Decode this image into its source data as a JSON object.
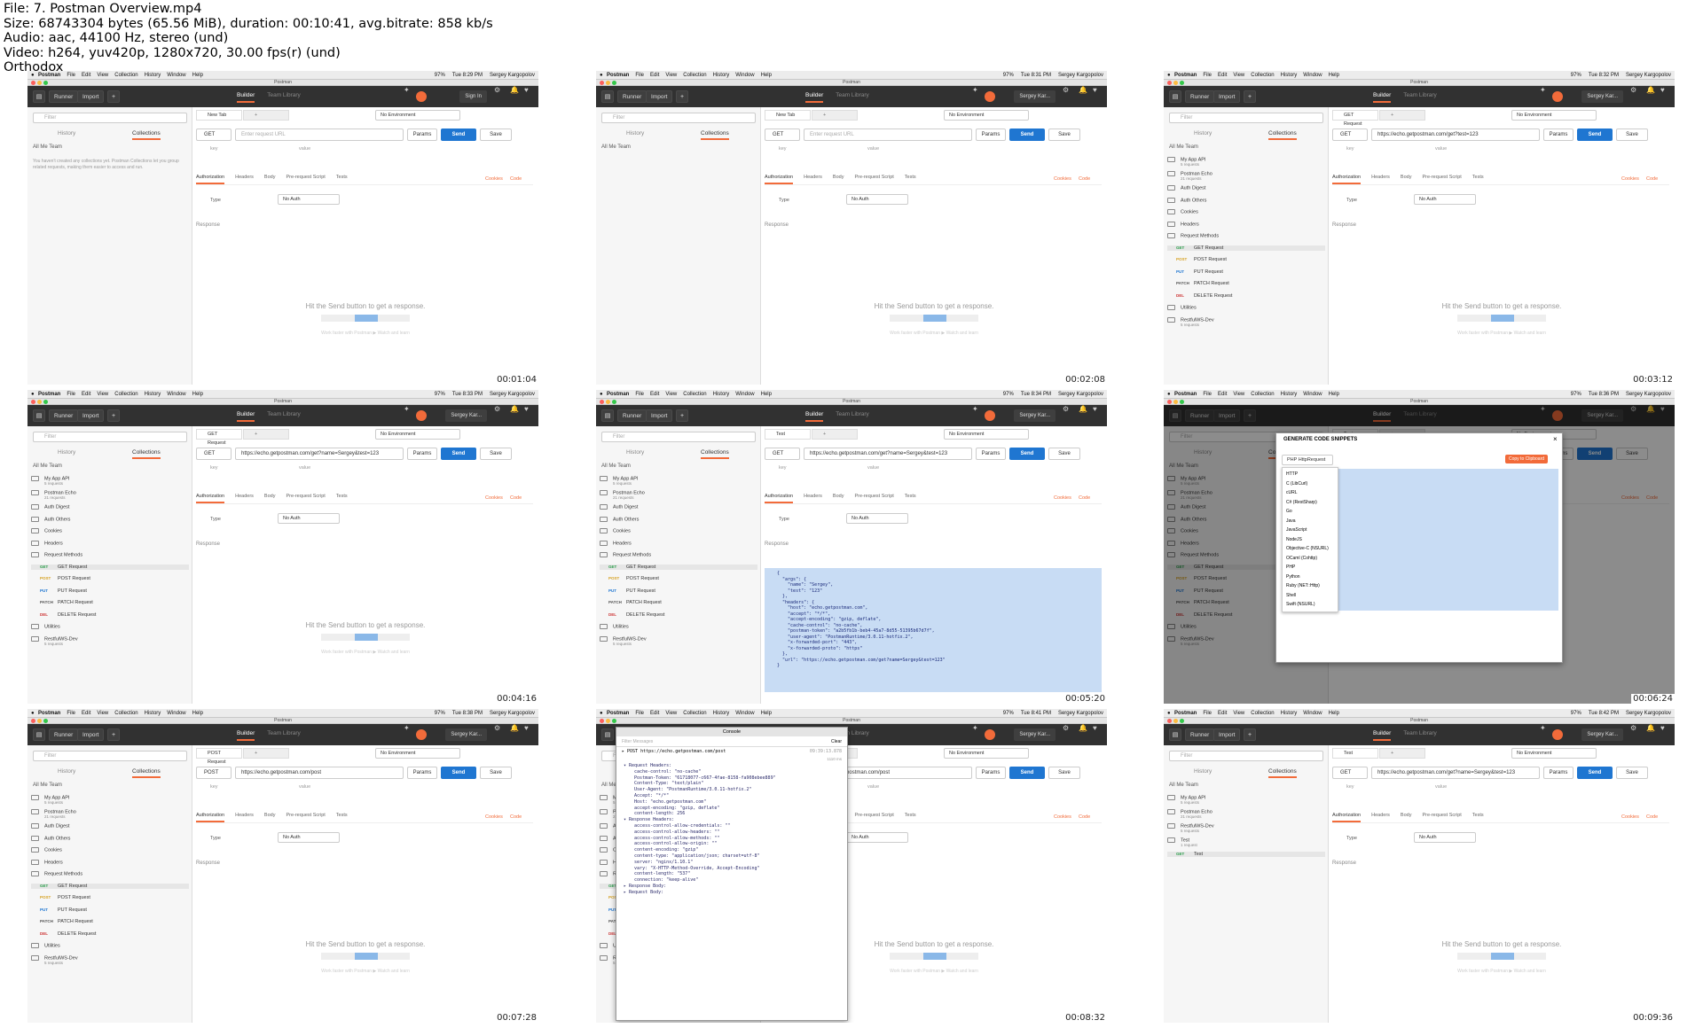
{
  "header": {
    "file": "File: 7. Postman Overview.mp4",
    "size": "Size: 68743304 bytes (65.56 MiB), duration: 00:10:41, avg.bitrate: 858 kb/s",
    "audio": "Audio: aac, 44100 Hz, stereo (und)",
    "video": "Video: h264, yuv420p, 1280x720, 30.00 fps(r) (und)",
    "brand": "Orthodox"
  },
  "common": {
    "apple": "",
    "app_name": "Postman",
    "menus": [
      "File",
      "Edit",
      "View",
      "Collection",
      "History",
      "Window",
      "Help"
    ],
    "battery": "97%",
    "user_name": "Sergey Kargopolov",
    "window_title": "Postman",
    "runner": "Runner",
    "import": "Import",
    "builder": "Builder",
    "team_library": "Team Library",
    "sign_in": "Sign In",
    "user_short": "Sergey Kar...",
    "filter": "Filter",
    "history": "History",
    "collections": "Collections",
    "me_team": "All  Me  Team",
    "new_tab": "New Tab",
    "no_env": "No Environment",
    "enter_url": "Enter request URL",
    "params": "Params",
    "send": "Send",
    "save": "Save",
    "key": "key",
    "value": "value",
    "bulk_edit": "Bulk Edit",
    "presets": "Presets",
    "cookies": "Cookies",
    "code": "Code",
    "response": "Response",
    "hit_send": "Hit the Send button to get a response.",
    "work_faster": "Work faster with Postman  ▶  Watch and learn",
    "sub_tabs": [
      "Authorization",
      "Headers",
      "Body",
      "Pre-request Script",
      "Tests"
    ],
    "type": "Type",
    "no_auth": "No Auth",
    "empty_msg": "You haven't created any collections yet. Postman Collections let you group related requests, making them easier to access and run."
  },
  "cells": [
    {
      "time": "Tue 8:29 PM",
      "ts": "00:01:04",
      "variant": "empty",
      "tab": "New Tab",
      "method": "GET",
      "url": ""
    },
    {
      "time": "Tue 8:31 PM",
      "ts": "00:02:08",
      "variant": "empty2",
      "tab": "New Tab",
      "method": "GET",
      "url": ""
    },
    {
      "time": "Tue 8:32 PM",
      "ts": "00:03:12",
      "variant": "list",
      "tab": "GET Request",
      "method": "GET",
      "url": "https://echo.getpostman.com/get?test=123"
    },
    {
      "time": "Tue 8:33 PM",
      "ts": "00:04:16",
      "variant": "list",
      "tab": "GET Request",
      "method": "GET",
      "url": "https://echo.getpostman.com/get?name=Sergey&test=123"
    },
    {
      "time": "Tue 8:34 PM",
      "ts": "00:05:20",
      "variant": "json",
      "tab": "Test",
      "method": "GET",
      "url": "https://echo.getpostman.com/get?name=Sergey&test=123"
    },
    {
      "time": "Tue 8:36 PM",
      "ts": "00:06:24",
      "variant": "modal",
      "tab": "Test",
      "method": "GET",
      "url": ""
    },
    {
      "time": "Tue 8:38 PM",
      "ts": "00:07:28",
      "variant": "list",
      "tab": "POST Request",
      "method": "POST",
      "url": "https://echo.getpostman.com/post"
    },
    {
      "time": "Tue 8:41 PM",
      "ts": "00:08:32",
      "variant": "console",
      "tab": "Test",
      "method": "POST",
      "url": "https://echo.getpostman.com/post"
    },
    {
      "time": "Tue 8:42 PM",
      "ts": "00:09:36",
      "variant": "list2",
      "tab": "Test",
      "method": "GET",
      "url": "https://echo.getpostman.com/get?name=Sergey&test=123"
    }
  ],
  "sidebar_list": [
    {
      "label": "My App API",
      "sub": "5 requests",
      "type": "folder"
    },
    {
      "label": "Postman Echo",
      "sub": "21 requests",
      "type": "folder"
    },
    {
      "label": "Auth Digest",
      "type": "folder"
    },
    {
      "label": "Auth Others",
      "type": "folder"
    },
    {
      "label": "Cookies",
      "type": "folder"
    },
    {
      "label": "Headers",
      "type": "folder"
    },
    {
      "label": "Request Methods",
      "type": "folder"
    },
    {
      "label": "GET Request",
      "method": "GET",
      "type": "req",
      "sel": true
    },
    {
      "label": "POST Request",
      "method": "POST",
      "type": "req"
    },
    {
      "label": "PUT Request",
      "method": "PUT",
      "type": "req"
    },
    {
      "label": "PATCH Request",
      "method": "PATCH",
      "type": "req"
    },
    {
      "label": "DELETE Request",
      "method": "DEL",
      "type": "req"
    },
    {
      "label": "Utilities",
      "type": "folder"
    },
    {
      "label": "RestfulWS-Dev",
      "sub": "5 requests",
      "type": "folder"
    }
  ],
  "sidebar_list2": [
    {
      "label": "My App API",
      "sub": "5 requests",
      "type": "folder"
    },
    {
      "label": "Postman Echo",
      "sub": "21 requests",
      "type": "folder"
    },
    {
      "label": "RestfulWS-Dev",
      "sub": "5 requests",
      "type": "folder"
    },
    {
      "label": "Test",
      "sub": "1 request",
      "type": "folder"
    },
    {
      "label": "Test",
      "method": "GET",
      "type": "req",
      "sel": true
    }
  ],
  "json_lines": [
    "{",
    "  \"args\": {",
    "    \"name\": \"Sergey\",",
    "    \"test\": \"123\"",
    "  },",
    "  \"headers\": {",
    "    \"host\": \"echo.getpostman.com\",",
    "    \"accept\": \"*/*\",",
    "    \"accept-encoding\": \"gzip, deflate\",",
    "    \"cache-control\": \"no-cache\",",
    "    \"postman-token\": \"a2b5fb1b-beb4-45a7-8d55-51395b67d7f\",",
    "    \"user-agent\": \"PostmanRuntime/3.0.11-hotfix.2\",",
    "    \"x-forwarded-port\": \"443\",",
    "    \"x-forwarded-proto\": \"https\"",
    "  },",
    "  \"url\": \"https://echo.getpostman.com/get?name=Sergey&test=123\"",
    "}"
  ],
  "modal": {
    "title": "GENERATE CODE SNIPPETS",
    "lang": "PHP HttpRequest",
    "copy": "Copy to Clipboard",
    "langs": [
      "HTTP",
      "C (LibCurl)",
      "cURL",
      "C# (RestSharp)",
      "Go",
      "Java",
      "JavaScript",
      "NodeJS",
      "Objective-C (NSURL)",
      "OCaml (Cohttp)",
      "PHP",
      "Python",
      "Ruby (NET::Http)",
      "Shell",
      "Swift (NSURL)"
    ]
  },
  "console": {
    "title": "Console",
    "filter": "Filter Messages",
    "clear": "Clear",
    "line1": "▸ POST  https://echo.getpostman.com/post",
    "time": "09:39:13.878",
    "ms": "1110 ms",
    "rows": [
      "▾ Request Headers:",
      "    cache-control: \"no-cache\"",
      "    Postman-Token: \"61718077-c667-4fae-8158-fa908ebee889\"",
      "    Content-Type: \"text/plain\"",
      "    User-Agent: \"PostmanRuntime/3.0.11-hotfix.2\"",
      "    Accept: \"*/*\"",
      "    Host: \"echo.getpostman.com\"",
      "    accept-encoding: \"gzip, deflate\"",
      "    content-length: 256",
      "▾ Response Headers:",
      "    access-control-allow-credentials: \"\"",
      "    access-control-allow-headers: \"\"",
      "    access-control-allow-methods: \"\"",
      "    access-control-allow-origin: \"\"",
      "    content-encoding: \"gzip\"",
      "    content-type: \"application/json; charset=utf-8\"",
      "    server: \"nginx/1.10.1\"",
      "    vary: \"X-HTTP-Method-Override, Accept-Encoding\"",
      "    content-length: \"537\"",
      "    connection: \"keep-alive\"",
      "▸ Response Body:",
      "▸ Request Body:"
    ]
  }
}
